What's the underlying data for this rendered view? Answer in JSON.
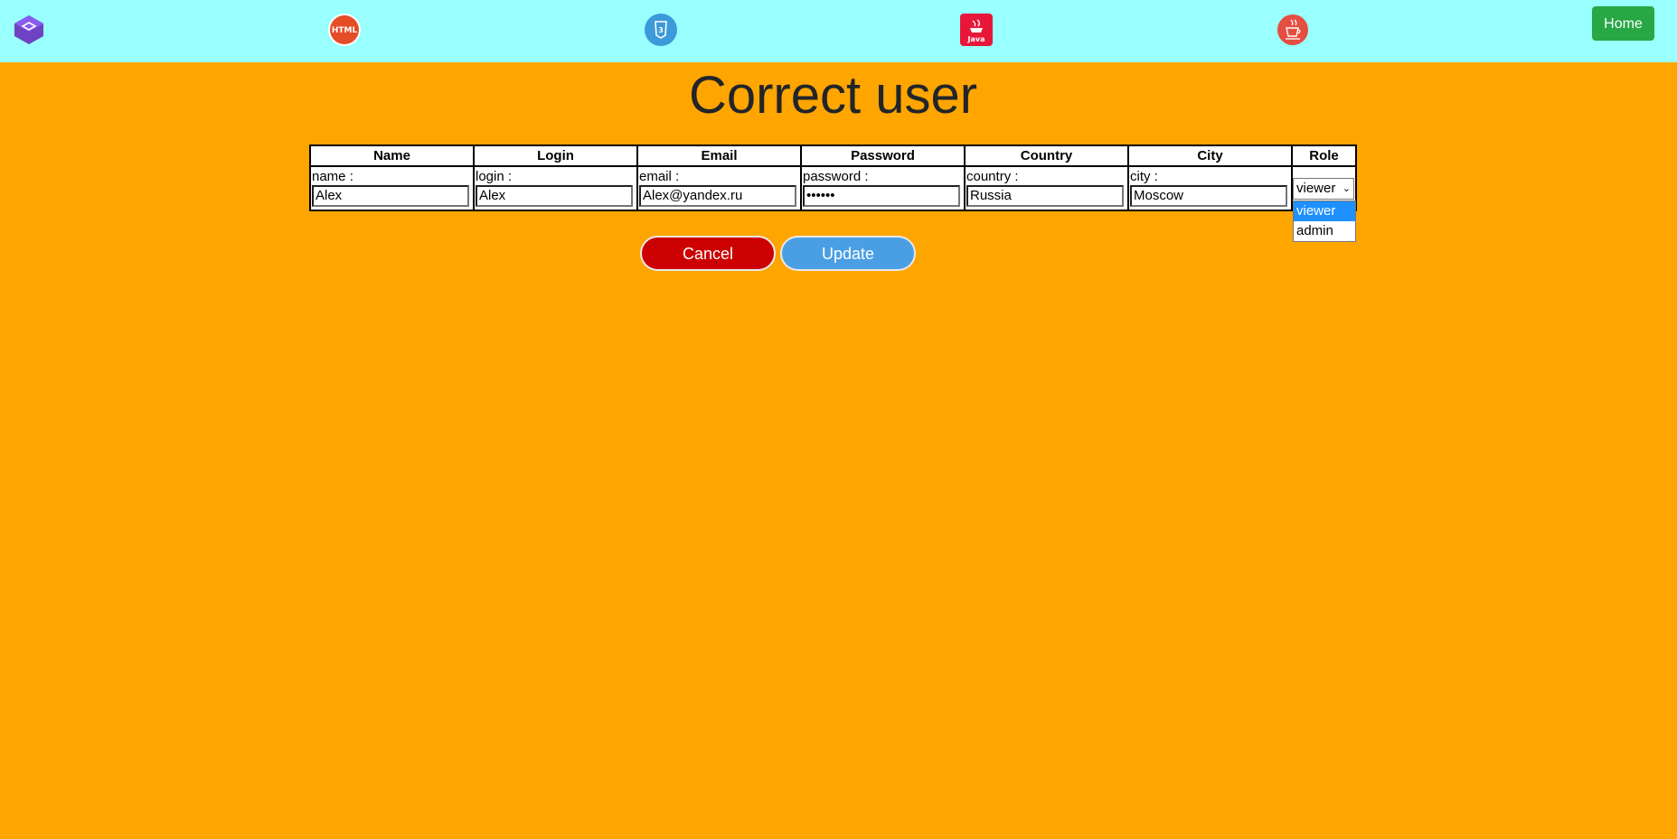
{
  "header": {
    "logos": [
      {
        "name": "bootstrap-icon"
      },
      {
        "name": "html-icon",
        "text": "HTML"
      },
      {
        "name": "css3-icon"
      },
      {
        "name": "java-icon",
        "text": "Java"
      },
      {
        "name": "java-cup-icon"
      }
    ],
    "home_label": "Home"
  },
  "page": {
    "title": "Correct user"
  },
  "table": {
    "headers": [
      "Name",
      "Login",
      "Email",
      "Password",
      "Country",
      "City",
      "Role"
    ],
    "fields": [
      {
        "label": "name :",
        "value": "Alex"
      },
      {
        "label": "login :",
        "value": "Alex"
      },
      {
        "label": "email :",
        "value": "Alex@yandex.ru"
      },
      {
        "label": "password :",
        "value": "••••••"
      },
      {
        "label": "country :",
        "value": "Russia"
      },
      {
        "label": "city :",
        "value": "Moscow"
      }
    ],
    "role": {
      "selected": "viewer",
      "options": [
        "viewer",
        "admin"
      ]
    }
  },
  "actions": {
    "cancel_label": "Cancel",
    "update_label": "Update"
  },
  "colors": {
    "topbar": "#99ffff",
    "page_background": "#ffa500",
    "home_button": "#28a745",
    "cancel_button": "#cc0000",
    "update_button": "#4a9fe4",
    "selected_option": "#1e90ff"
  }
}
